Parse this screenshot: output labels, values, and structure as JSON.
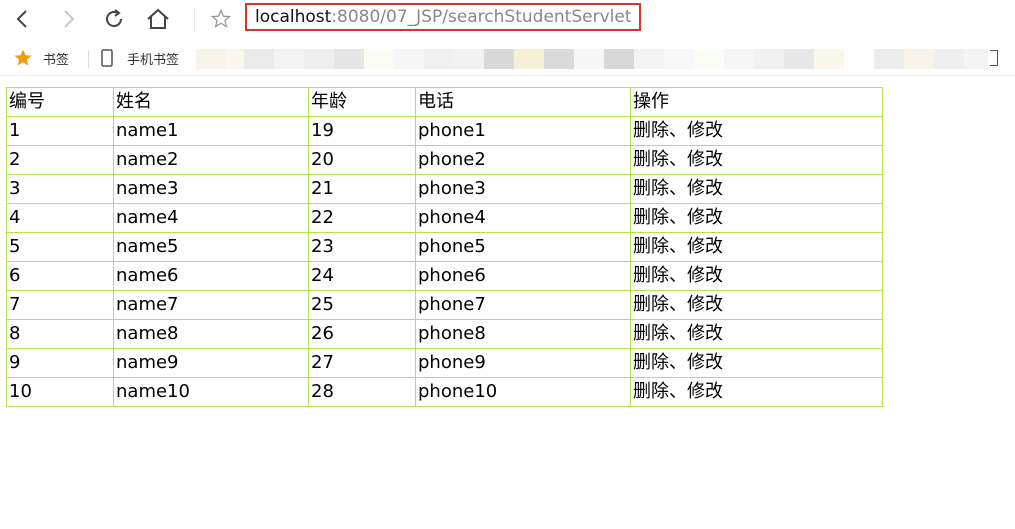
{
  "browser": {
    "address": {
      "host": "localhost",
      "rest": ":8080/07_JSP/searchStudentServlet"
    },
    "icons": [
      "back-icon",
      "forward-icon",
      "reload-icon",
      "home-icon",
      "star-outline-icon"
    ]
  },
  "bookmarks": {
    "folder_label": "书签",
    "mobile_label": "手机书签",
    "icons": [
      "star-filled-icon",
      "phone-icon"
    ],
    "colors": {
      "star": "#f39c12"
    }
  },
  "table": {
    "headers": [
      "编号",
      "姓名",
      "年龄",
      "电话",
      "操作"
    ],
    "rows": [
      [
        "1",
        "name1",
        "19",
        "phone1",
        "删除、修改"
      ],
      [
        "2",
        "name2",
        "20",
        "phone2",
        "删除、修改"
      ],
      [
        "3",
        "name3",
        "21",
        "phone3",
        "删除、修改"
      ],
      [
        "4",
        "name4",
        "22",
        "phone4",
        "删除、修改"
      ],
      [
        "5",
        "name5",
        "23",
        "phone5",
        "删除、修改"
      ],
      [
        "6",
        "name6",
        "24",
        "phone6",
        "删除、修改"
      ],
      [
        "7",
        "name7",
        "25",
        "phone7",
        "删除、修改"
      ],
      [
        "8",
        "name8",
        "26",
        "phone8",
        "删除、修改"
      ],
      [
        "9",
        "name9",
        "27",
        "phone9",
        "删除、修改"
      ],
      [
        "10",
        "name10",
        "28",
        "phone10",
        "删除、修改"
      ]
    ],
    "colors": {
      "border": "#b4e34a"
    }
  }
}
